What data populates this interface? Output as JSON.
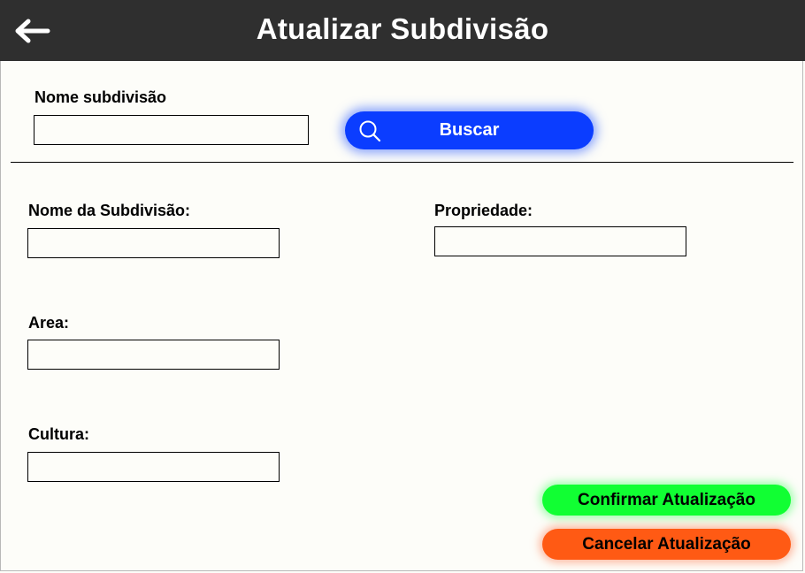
{
  "header": {
    "title": "Atualizar Subdivisão",
    "back_icon": "arrow-left-icon"
  },
  "search": {
    "label": "Nome subdivisão",
    "value": "",
    "button_label": "Buscar",
    "button_icon": "search-icon",
    "button_color": "#0b3dff"
  },
  "form": {
    "nome_label": "Nome da Subdivisão:",
    "nome_value": "",
    "propriedade_label": "Propriedade:",
    "propriedade_value": "",
    "area_label": "Area:",
    "area_value": "",
    "cultura_label": "Cultura:",
    "cultura_value": ""
  },
  "actions": {
    "confirm_label": "Confirmar Atualização",
    "confirm_color": "#11ff33",
    "cancel_label": "Cancelar Atualização",
    "cancel_color": "#ff5a14"
  }
}
